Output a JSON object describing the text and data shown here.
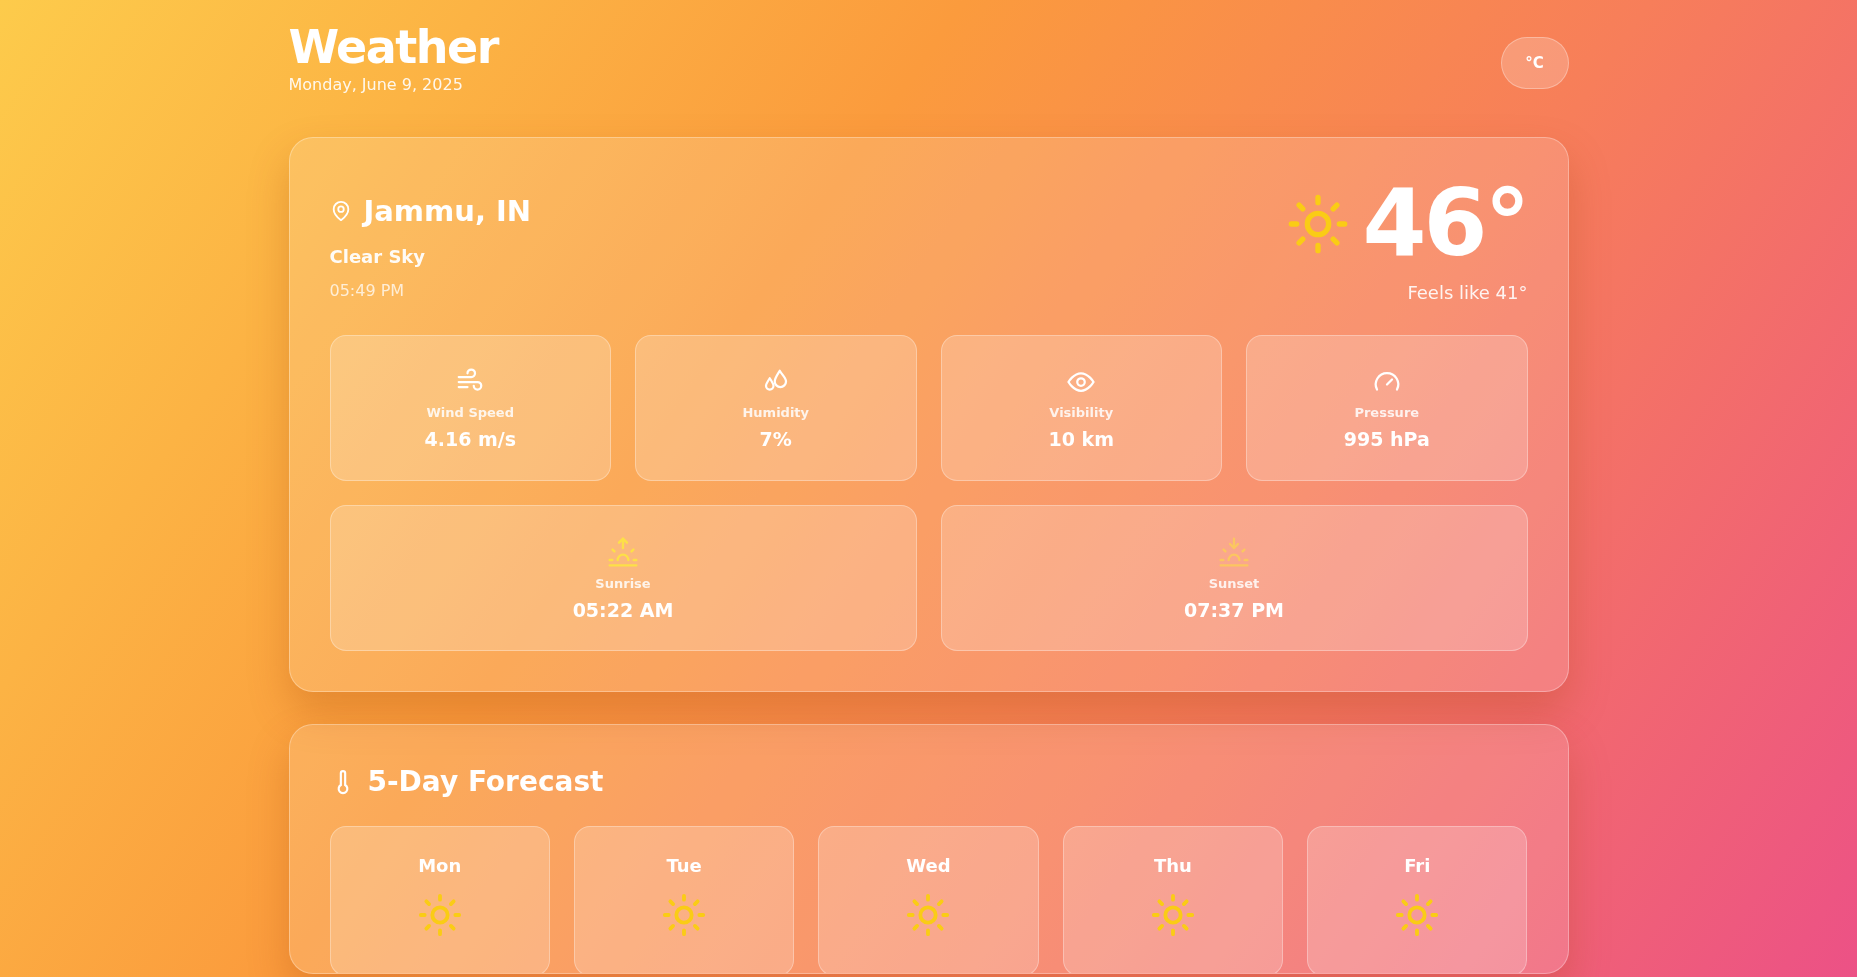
{
  "header": {
    "title": "Weather",
    "date": "Monday, June 9, 2025",
    "unit_button": "°C"
  },
  "current": {
    "location": "Jammu, IN",
    "condition": "Clear Sky",
    "time": "05:49 PM",
    "temperature": "46°",
    "feels_like": "Feels like 41°",
    "stats": [
      {
        "kind": "wind",
        "label": "Wind Speed",
        "value": "4.16 m/s"
      },
      {
        "kind": "humidity",
        "label": "Humidity",
        "value": "7%"
      },
      {
        "kind": "visibility",
        "label": "Visibility",
        "value": "10 km"
      },
      {
        "kind": "pressure",
        "label": "Pressure",
        "value": "995 hPa"
      }
    ],
    "sun_events": [
      {
        "kind": "sunrise",
        "label": "Sunrise",
        "value": "05:22 AM"
      },
      {
        "kind": "sunset",
        "label": "Sunset",
        "value": "07:37 PM"
      }
    ]
  },
  "forecast": {
    "title": "5-Day Forecast",
    "days": [
      {
        "day": "Mon"
      },
      {
        "day": "Tue"
      },
      {
        "day": "Wed"
      },
      {
        "day": "Thu"
      },
      {
        "day": "Fri"
      }
    ]
  }
}
